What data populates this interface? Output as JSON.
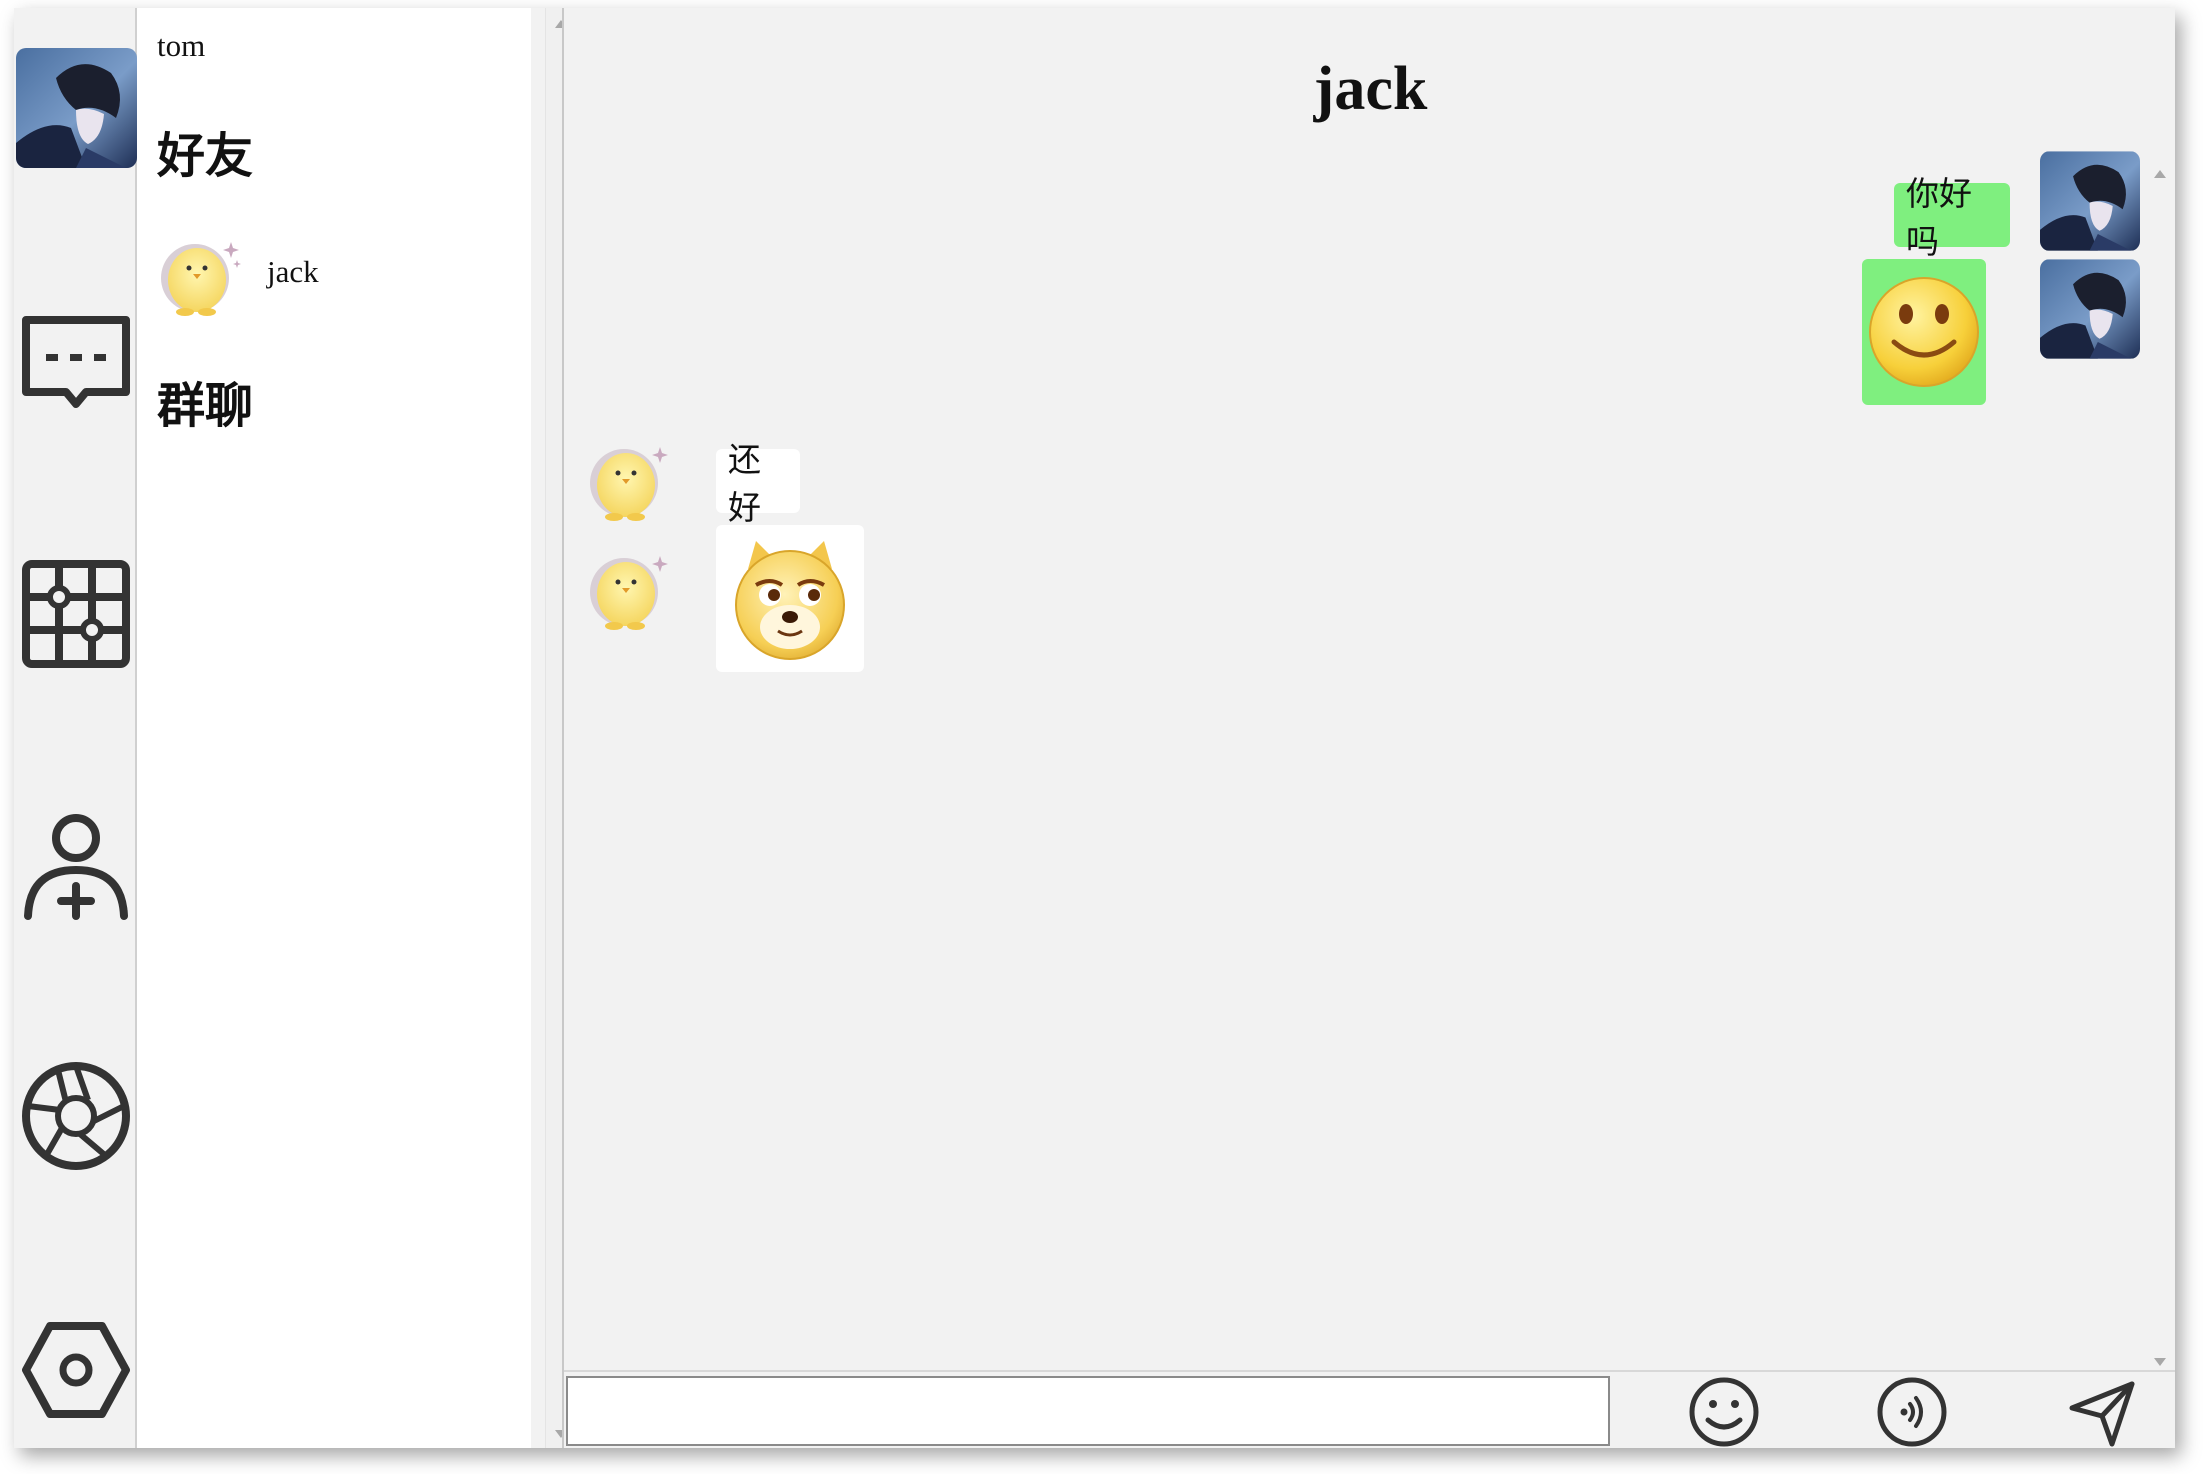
{
  "app": {
    "current_user": "tom"
  },
  "rail": {
    "items": [
      {
        "name": "messages",
        "icon": "chat-bubble-icon"
      },
      {
        "name": "apps",
        "icon": "grid-apps-icon"
      },
      {
        "name": "add-friend",
        "icon": "add-user-icon"
      },
      {
        "name": "moments",
        "icon": "aperture-icon"
      },
      {
        "name": "settings",
        "icon": "hexagon-settings-icon"
      }
    ]
  },
  "contacts": {
    "friends_heading": "好友",
    "groups_heading": "群聊",
    "friends": [
      {
        "name": "jack",
        "avatar": "chick-avatar"
      }
    ]
  },
  "chat": {
    "title": "jack",
    "messages": [
      {
        "from": "me",
        "type": "text",
        "text": "你好吗"
      },
      {
        "from": "me",
        "type": "emoji",
        "emoji": "smiley-face-emoji"
      },
      {
        "from": "jack",
        "type": "text",
        "text": "还好"
      },
      {
        "from": "jack",
        "type": "emoji",
        "emoji": "doge-emoji"
      }
    ],
    "input": {
      "value": "",
      "placeholder": ""
    },
    "tools": [
      {
        "name": "emoji",
        "icon": "smiley-icon"
      },
      {
        "name": "voice",
        "icon": "voice-icon"
      },
      {
        "name": "send",
        "icon": "send-icon"
      }
    ]
  },
  "colors": {
    "my_bubble": "#7fef7f",
    "their_bubble": "#ffffff",
    "background": "#f2f2f2",
    "icon_stroke": "#333333"
  }
}
